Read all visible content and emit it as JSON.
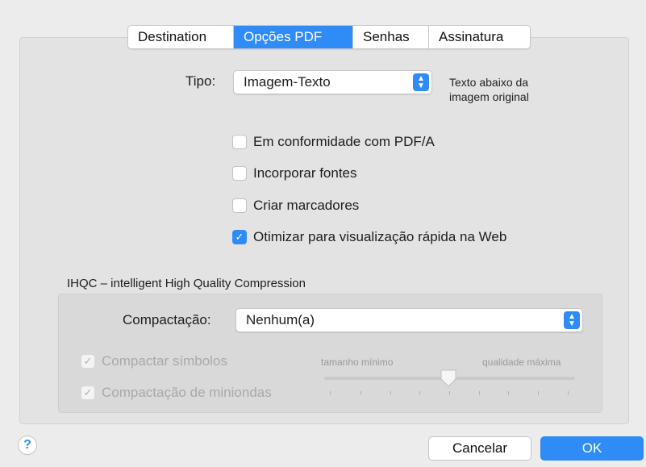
{
  "tabs": [
    {
      "label": "Destination",
      "active": false
    },
    {
      "label": "Opções PDF",
      "active": true
    },
    {
      "label": "Senhas",
      "active": false
    },
    {
      "label": "Assinatura",
      "active": false
    }
  ],
  "tipo": {
    "label": "Tipo:",
    "value": "Imagem-Texto",
    "note_line1": "Texto abaixo da",
    "note_line2": "imagem original"
  },
  "options": [
    {
      "label": "Em conformidade com PDF/A",
      "checked": false
    },
    {
      "label": "Incorporar fontes",
      "checked": false
    },
    {
      "label": "Criar marcadores",
      "checked": false
    },
    {
      "label": "Otimizar para visualização rápida na Web",
      "checked": true
    }
  ],
  "ihqc": {
    "title": "IHQC – intelligent High Quality Compression",
    "compactacao_label": "Compactação:",
    "compactacao_value": "Nenhum(a)",
    "compactar_simbolos": "Compactar símbolos",
    "compactacao_miniondas": "Compactação de miniondas",
    "slider_min_label": "tamanho mínimo",
    "slider_max_label": "qualidade máxima",
    "slider_level": 0.5
  },
  "footer": {
    "help": "?",
    "cancel": "Cancelar",
    "ok": "OK"
  },
  "colors": {
    "accent": "#2f8cf6"
  }
}
